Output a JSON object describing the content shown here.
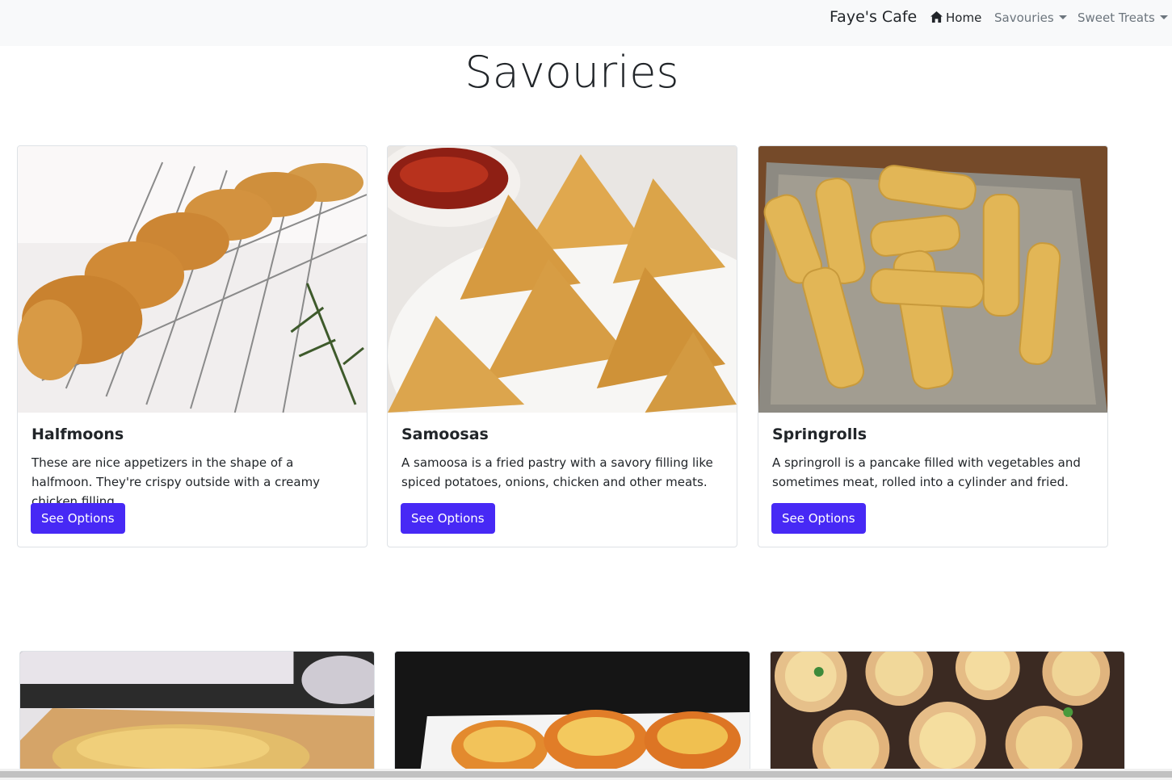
{
  "navbar": {
    "brand": "Faye's Cafe",
    "home_label": "Home",
    "savouries_label": "Savouries",
    "sweet_treats_label": "Sweet Treats"
  },
  "page": {
    "title": "Savouries"
  },
  "cards": [
    {
      "title": "Halfmoons",
      "text": "These are nice appetizers in the shape of a halfmoon. They're crispy outside with a creamy chicken filling.",
      "button": "See Options"
    },
    {
      "title": "Samoosas",
      "text": "A samoosa is a fried pastry with a savory filling like spiced potatoes, onions, chicken and other meats.",
      "button": "See Options"
    },
    {
      "title": "Springrolls",
      "text": "A springroll is a pancake filled with vegetables and sometimes meat, rolled into a cylinder and fried.",
      "button": "See Options"
    }
  ],
  "colors": {
    "accent": "#4729f5",
    "navbar_bg": "#f8f9fa",
    "muted": "#6c757d"
  },
  "icons": {
    "home": "home-icon",
    "dropdown": "caret-down-icon"
  }
}
